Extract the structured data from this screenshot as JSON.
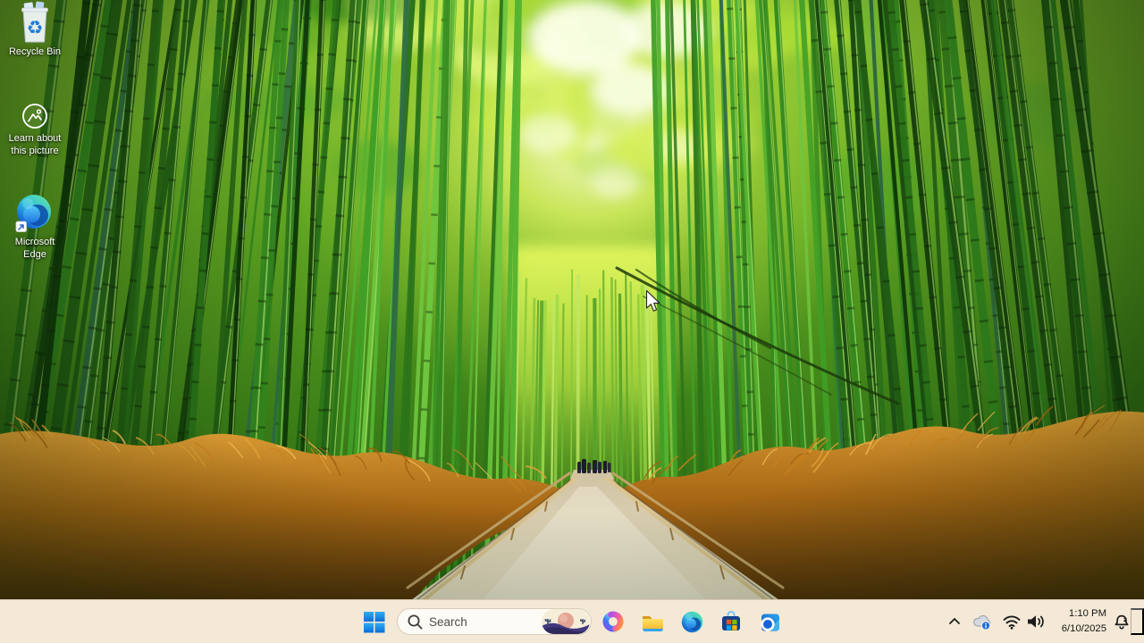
{
  "desktop": {
    "icons": [
      {
        "id": "recycle-bin",
        "label_line1": "Recycle Bin",
        "label_line2": ""
      },
      {
        "id": "learn-about-this-picture",
        "label_line1": "Learn about",
        "label_line2": "this picture"
      },
      {
        "id": "microsoft-edge",
        "label_line1": "Microsoft",
        "label_line2": "Edge"
      }
    ]
  },
  "taskbar": {
    "search": {
      "placeholder": "Search"
    },
    "apps": [
      {
        "name": "copilot"
      },
      {
        "name": "file-explorer"
      },
      {
        "name": "edge"
      },
      {
        "name": "microsoft-store"
      },
      {
        "name": "outlook"
      }
    ],
    "tray": {
      "icons": [
        "chevron-up",
        "onedrive-cloud",
        "wifi",
        "volume"
      ],
      "time": "1:10 PM",
      "date": "6/10/2025",
      "notification": "bell-do-not-disturb"
    }
  },
  "colors": {
    "taskbar_bg": "#f4e9d6",
    "start_blue": "#159ce6",
    "search_text": "#4d4d4d",
    "tray_text": "#141414"
  }
}
